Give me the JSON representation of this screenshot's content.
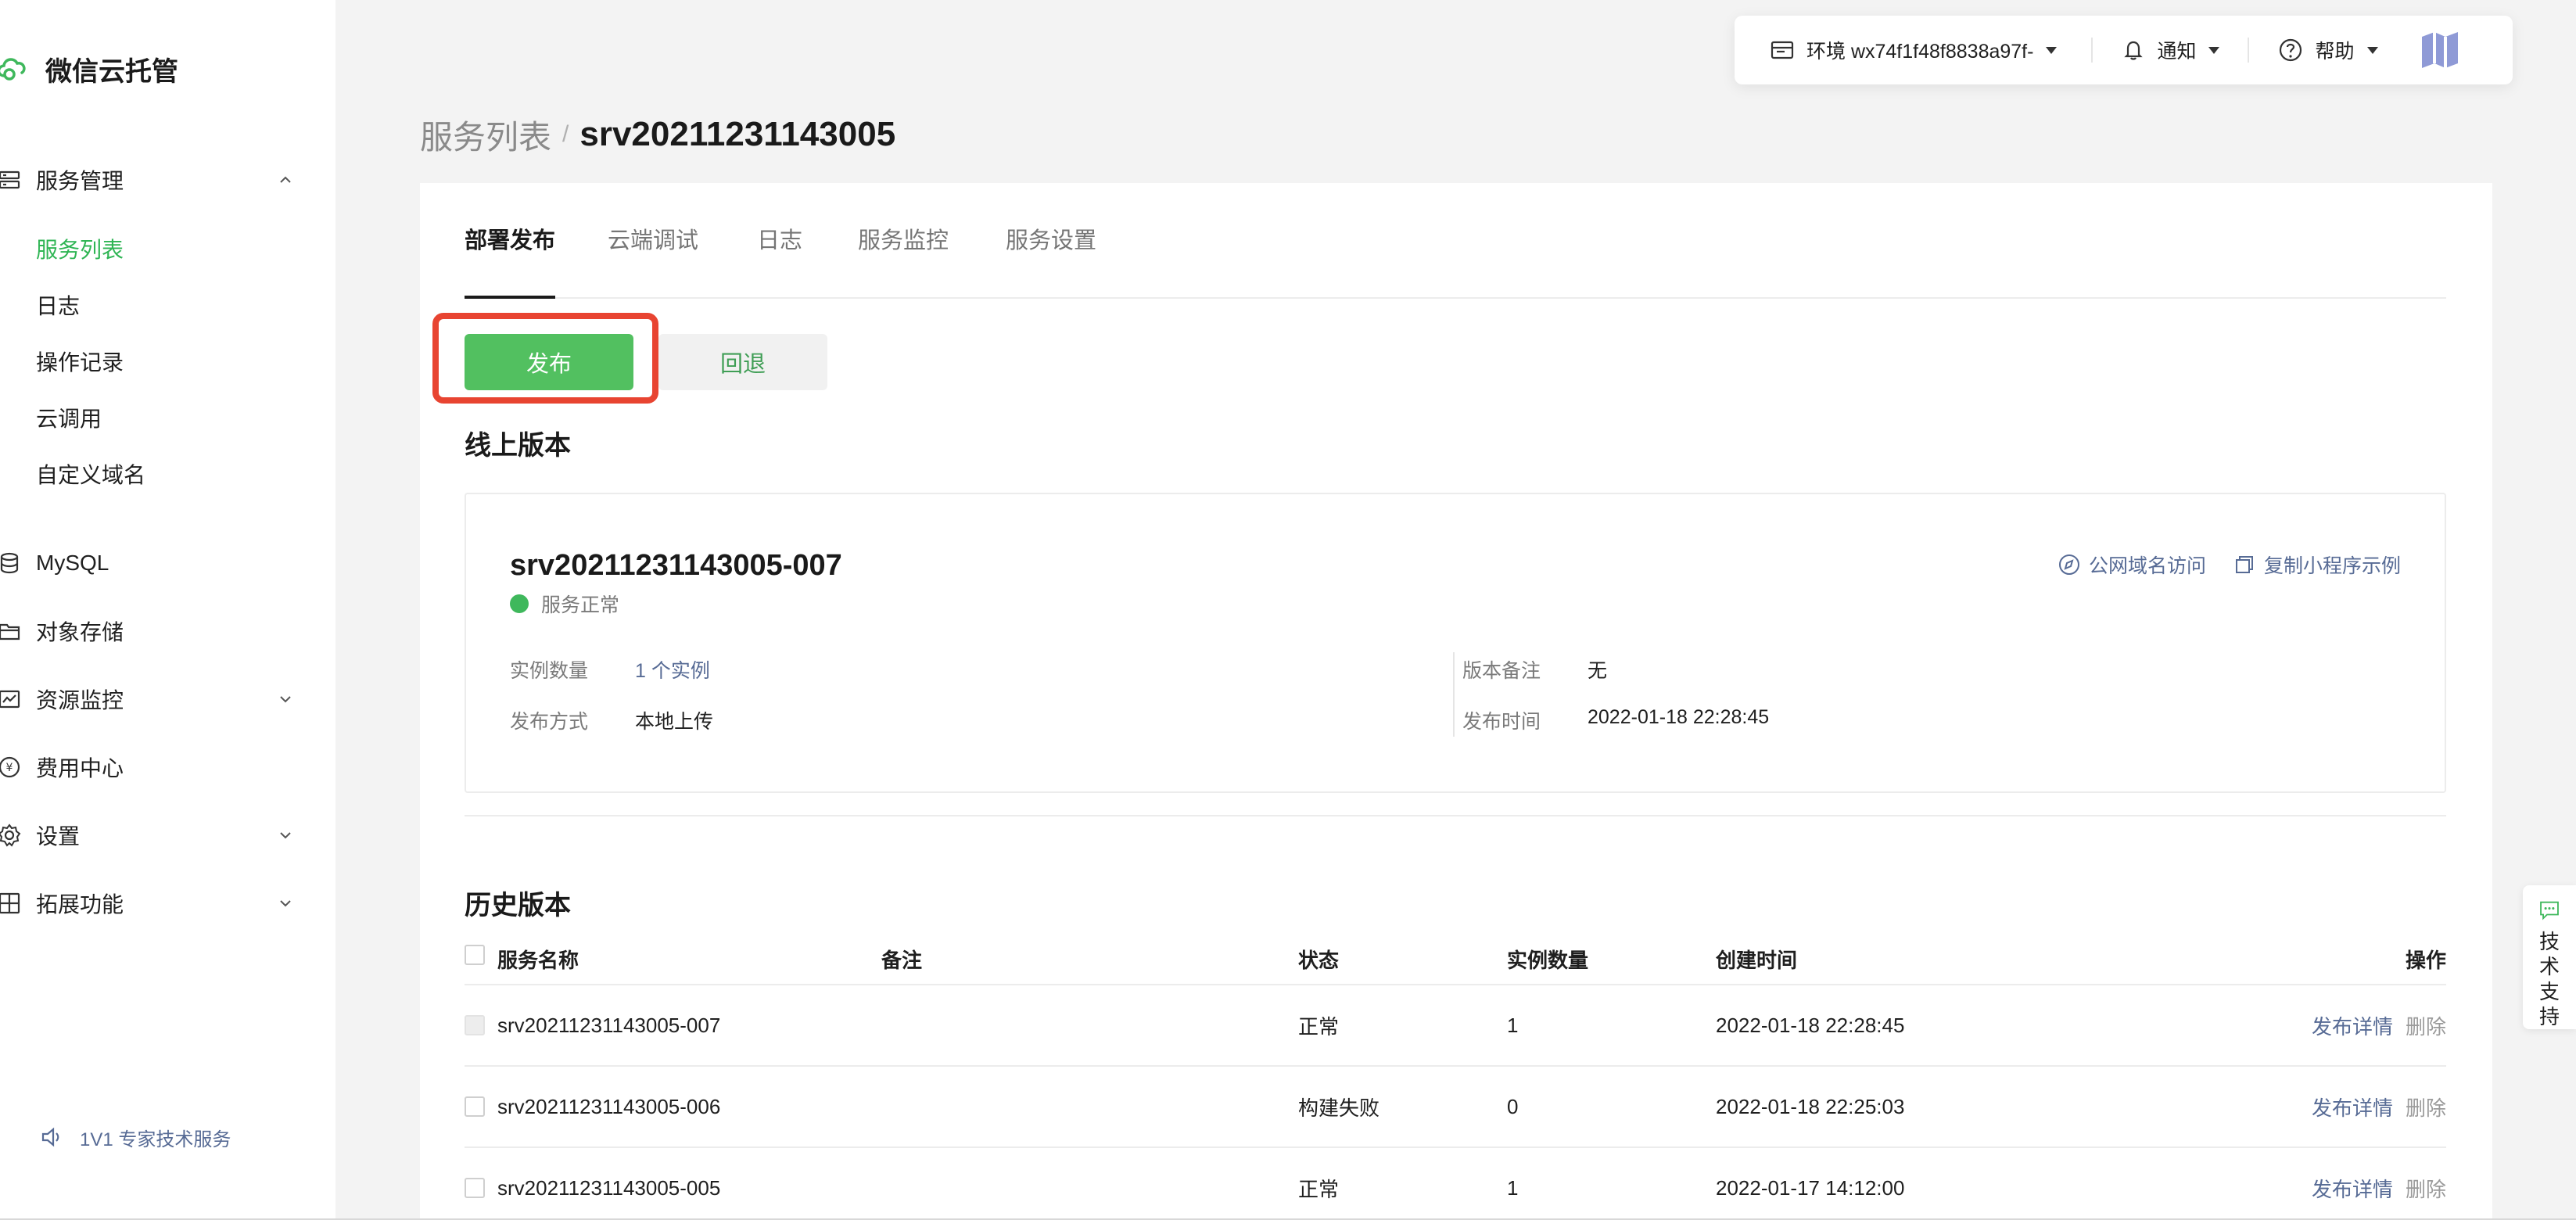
{
  "app": {
    "name": "微信云托管"
  },
  "sidebar": {
    "groups": [
      {
        "label": "服务管理",
        "expanded": true,
        "icon": "service-icon"
      },
      {
        "label": "MySQL",
        "icon": "database-icon"
      },
      {
        "label": "对象存储",
        "icon": "folder-icon"
      },
      {
        "label": "资源监控",
        "icon": "chart-icon"
      },
      {
        "label": "费用中心",
        "icon": "yen-icon"
      },
      {
        "label": "设置",
        "icon": "gear-icon"
      },
      {
        "label": "拓展功能",
        "icon": "extension-icon"
      }
    ],
    "service_items": [
      "服务列表",
      "日志",
      "操作记录",
      "云调用",
      "自定义域名"
    ],
    "active_item": "服务列表",
    "support_link": "1V1 专家技术服务"
  },
  "topbar": {
    "env_label": "环境 wx74f1f48f8838a97f-",
    "notify_label": "通知",
    "help_label": "帮助"
  },
  "breadcrumb": {
    "parent": "服务列表",
    "separator": "/",
    "current": "srv20211231143005"
  },
  "tabs": [
    "部署发布",
    "云端调试",
    "日志",
    "服务监控",
    "服务设置"
  ],
  "actions": {
    "publish": "发布",
    "rollback": "回退"
  },
  "online": {
    "section_title": "线上版本",
    "version_name": "srv20211231143005-007",
    "status": "服务正常",
    "public_domain_link": "公网域名访问",
    "copy_example_link": "复制小程序示例",
    "fields": {
      "instances_label": "实例数量",
      "instances_value": "1 个实例",
      "method_label": "发布方式",
      "method_value": "本地上传",
      "remark_label": "版本备注",
      "remark_value": "无",
      "time_label": "发布时间",
      "time_value": "2022-01-18 22:28:45"
    }
  },
  "history": {
    "section_title": "历史版本",
    "columns": {
      "name": "服务名称",
      "remark": "备注",
      "status": "状态",
      "instances": "实例数量",
      "created": "创建时间",
      "ops": "操作"
    },
    "rows": [
      {
        "name": "srv20211231143005-007",
        "remark": "",
        "status": "正常",
        "instances": "1",
        "created": "2022-01-18 22:28:45",
        "detail": "发布详情",
        "delete": "删除"
      },
      {
        "name": "srv20211231143005-006",
        "remark": "",
        "status": "构建失败",
        "instances": "0",
        "created": "2022-01-18 22:25:03",
        "detail": "发布详情",
        "delete": "删除"
      },
      {
        "name": "srv20211231143005-005",
        "remark": "",
        "status": "正常",
        "instances": "1",
        "created": "2022-01-17 14:12:00",
        "detail": "发布详情",
        "delete": "删除"
      }
    ]
  },
  "float_support": {
    "label": "技术支持"
  },
  "colors": {
    "accent_green": "#52c060",
    "link_blue": "#576b95",
    "highlight_red": "#e84431"
  }
}
